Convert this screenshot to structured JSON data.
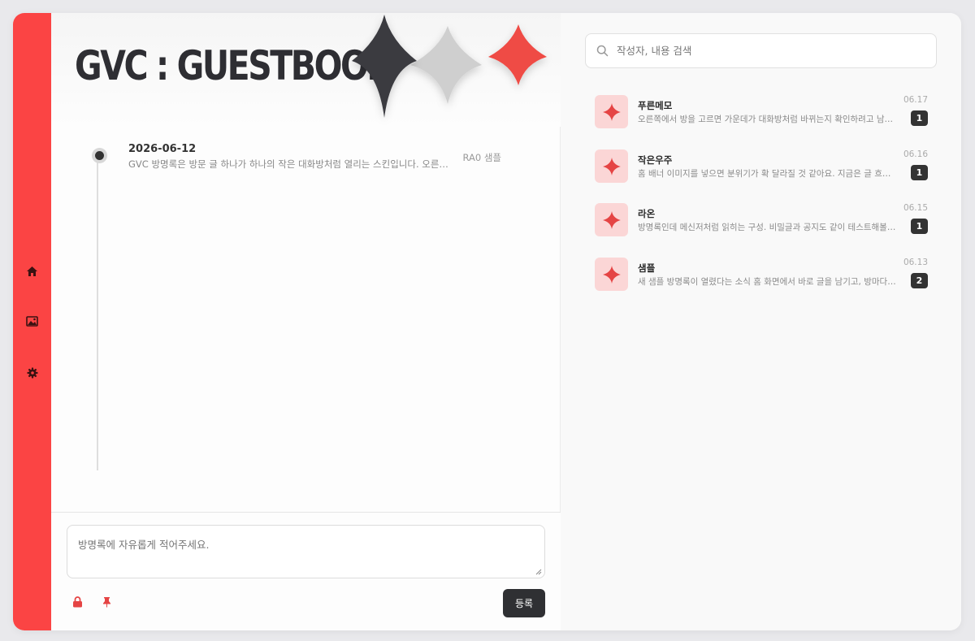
{
  "header": {
    "title": "GVC : GUESTBOOK"
  },
  "rail": {
    "items": [
      {
        "icon": "home-icon"
      },
      {
        "icon": "image-icon"
      },
      {
        "icon": "gear-icon"
      }
    ]
  },
  "timeline": {
    "posts": [
      {
        "date": "2026-06-12",
        "body": "GVC 방명록은 방문 글 하나가 하나의 작은 대화방처럼 열리는 스킨입니다. 오른쪽에서 방을 고르면...",
        "author": "RA0 샘플"
      }
    ]
  },
  "composer": {
    "placeholder": "방명록에 자유롭게 적어주세요.",
    "submit_label": "등록",
    "tools": [
      "lock-icon",
      "pin-icon"
    ]
  },
  "search": {
    "placeholder": "작성자, 내용 검색"
  },
  "rooms": [
    {
      "name": "푸른메모",
      "preview": "오른쪽에서 방을 고르면 가운데가 대화방처럼 바뀌는지 확인하려고 남겨요.",
      "date": "06.17",
      "count": "1"
    },
    {
      "name": "작은우주",
      "preview": "홈 배너 이미지를 넣으면 분위기가 확 달라질 것 같아요. 지금은 글 흐름 확인용입니다.",
      "date": "06.16",
      "count": "1"
    },
    {
      "name": "라온",
      "preview": "방명록인데 메신저처럼 읽히는 구성. 비밀글과 공지도 같이 테스트해볼게요.",
      "date": "06.15",
      "count": "1"
    },
    {
      "name": "샘플",
      "preview": "새 샘플 방명록이 열렸다는 소식 홈 화면에서 바로 글을 남기고, 방마다 답글을 달 수 있어요.",
      "date": "06.13",
      "count": "2"
    }
  ],
  "colors": {
    "accent": "#fb4444",
    "dark": "#2f3033",
    "thumb_bg": "#fbd6d6",
    "spark_gray": "#cfcfcf",
    "spark_red": "#ef4b44"
  }
}
